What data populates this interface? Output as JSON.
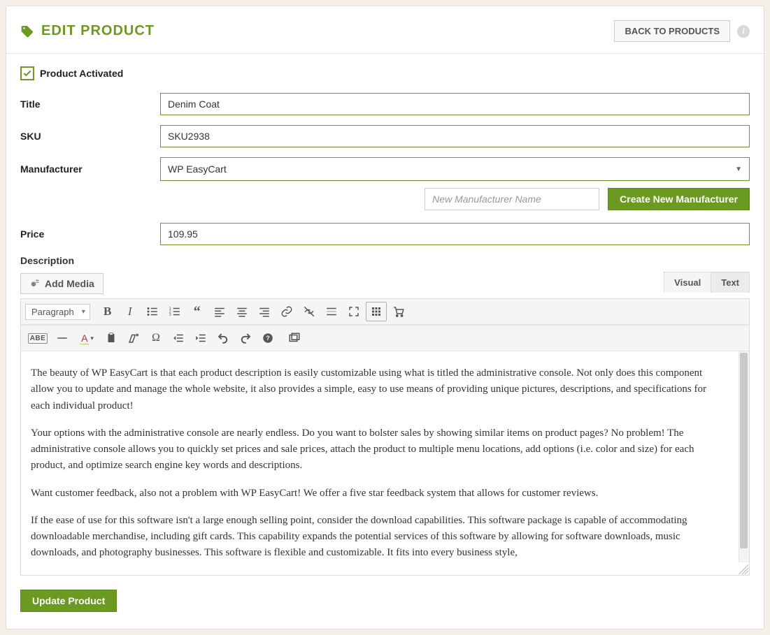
{
  "header": {
    "title": "EDIT PRODUCT",
    "back_label": "BACK TO PRODUCTS"
  },
  "activated_label": "Product Activated",
  "form": {
    "title_label": "Title",
    "title_value": "Denim Coat",
    "sku_label": "SKU",
    "sku_value": "SKU2938",
    "mfr_label": "Manufacturer",
    "mfr_value": "WP EasyCart",
    "mfr_new_placeholder": "New Manufacturer Name",
    "mfr_create_label": "Create New Manufacturer",
    "price_label": "Price",
    "price_value": "109.95",
    "desc_label": "Description"
  },
  "editor": {
    "add_media_label": "Add Media",
    "tab_visual": "Visual",
    "tab_text": "Text",
    "para_label": "Paragraph",
    "content_p1": "The beauty of WP EasyCart is that each product description is easily customizable using what is titled the administrative console. Not only does this component allow you to update and manage the whole website, it also provides a simple, easy to use means of providing unique pictures, descriptions, and specifications for each individual product!",
    "content_p2": "Your options with the administrative console are nearly endless. Do you want to bolster sales by showing similar items on product pages? No problem! The administrative console allows you to quickly set prices and sale prices, attach the product to multiple menu locations, add options (i.e. color and size) for each product, and optimize search engine key words and descriptions.",
    "content_p3": "Want customer feedback, also not a problem with WP EasyCart! We offer a five star feedback system that allows for customer reviews.",
    "content_p4": "If the ease of use for this software isn't a large enough selling point, consider the download capabilities. This software package is capable of accommodating downloadable merchandise, including gift cards. This capability expands the potential services of this software by allowing for software downloads, music downloads, and photography businesses. This software is flexible and customizable. It fits into every business style,"
  },
  "footer": {
    "update_label": "Update Product"
  }
}
